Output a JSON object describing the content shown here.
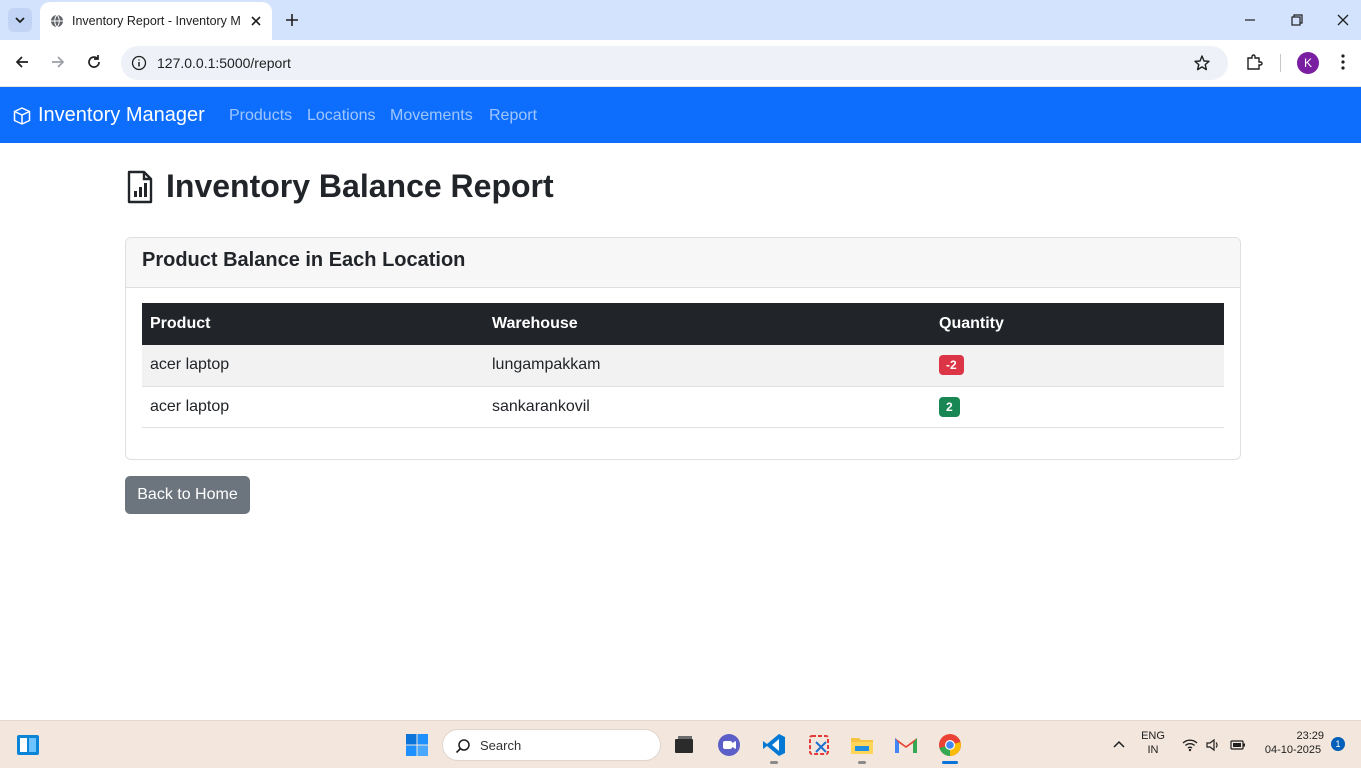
{
  "browser": {
    "tab_title": "Inventory Report - Inventory Manager",
    "url": "127.0.0.1:5000/report",
    "profile_initial": "K"
  },
  "navbar": {
    "brand": "Inventory Manager",
    "links": [
      "Products",
      "Locations",
      "Movements",
      "Report"
    ]
  },
  "page": {
    "title": "Inventory Balance Report",
    "card_title": "Product Balance in Each Location",
    "table": {
      "headers": [
        "Product",
        "Warehouse",
        "Quantity"
      ],
      "rows": [
        {
          "product": "acer laptop",
          "warehouse": "lungampakkam",
          "quantity": "-2"
        },
        {
          "product": "acer laptop",
          "warehouse": "sankarankovil",
          "quantity": "2"
        }
      ]
    },
    "back_button": "Back to Home"
  },
  "taskbar": {
    "search_placeholder": "Search",
    "language_top": "ENG",
    "language_bottom": "IN",
    "time": "23:29",
    "date": "04-10-2025",
    "notification_count": "1"
  },
  "colors": {
    "navbar": "#0d6efd",
    "badge_negative": "#dc3545",
    "badge_positive": "#198754",
    "table_header": "#212529",
    "back_button": "#6c757d"
  }
}
